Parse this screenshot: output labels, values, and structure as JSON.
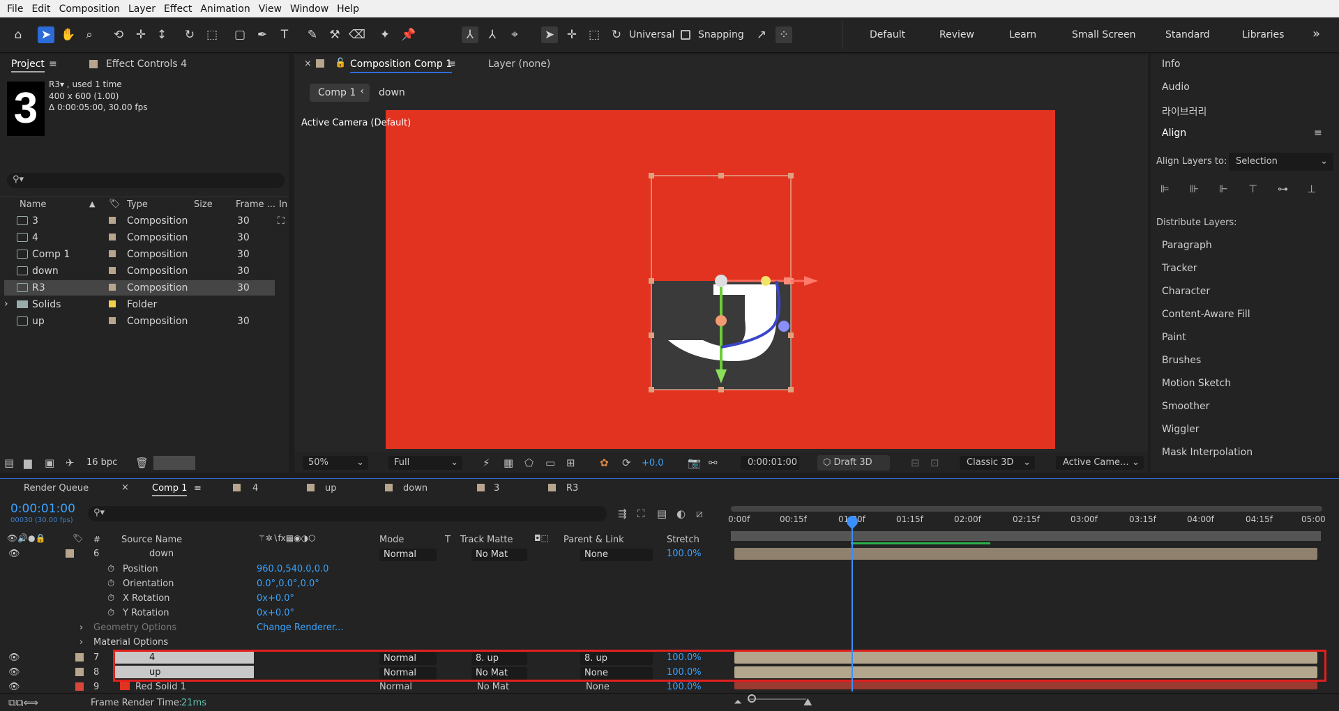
{
  "menu": [
    "File",
    "Edit",
    "Composition",
    "Layer",
    "Effect",
    "Animation",
    "View",
    "Window",
    "Help"
  ],
  "toolbar": {
    "universal_label": "Universal",
    "snapping_label": "Snapping"
  },
  "workspaces": [
    "Default",
    "Review",
    "Learn",
    "Small Screen",
    "Standard",
    "Libraries"
  ],
  "workspaces_more": "»",
  "project": {
    "tab_project": "Project",
    "tab_effect": "Effect Controls 4",
    "thumb_text": "3",
    "item_name": "R3▾ , used 1 time",
    "item_dims": "400 x 600 (1.00)",
    "item_dur": "Δ 0:00:05:00, 30.00 fps",
    "search_icon": "⚲▾",
    "cols": {
      "name": "Name",
      "type": "Type",
      "size": "Size",
      "frame": "Frame ...",
      "in": "In"
    },
    "items": [
      {
        "name": "3",
        "type": "Composition",
        "frame": "30"
      },
      {
        "name": "4",
        "type": "Composition",
        "frame": "30"
      },
      {
        "name": "Comp 1",
        "type": "Composition",
        "frame": "30"
      },
      {
        "name": "down",
        "type": "Composition",
        "frame": "30"
      },
      {
        "name": "R3",
        "type": "Composition",
        "frame": "30"
      },
      {
        "name": "Solids",
        "type": "Folder",
        "frame": ""
      },
      {
        "name": "up",
        "type": "Composition",
        "frame": "30"
      }
    ],
    "bpc": "16 bpc"
  },
  "comp": {
    "tab": "Composition Comp 1",
    "layer_tab": "Layer (none)",
    "crumb1": "Comp 1",
    "crumb2": "down",
    "camera": "Active Camera (Default)",
    "zoom": "50%",
    "res": "Full",
    "exposure": "+0.0",
    "time": "0:00:01:00",
    "draft": "Draft 3D",
    "renderer": "Classic 3D",
    "view": "Active Came...",
    "bg_color": "#e23321"
  },
  "right_panels": [
    "Info",
    "Audio",
    "라이브러리",
    "Align"
  ],
  "align": {
    "label": "Align Layers to:",
    "value": "Selection",
    "distribute": "Distribute Layers:"
  },
  "right_more": [
    "Paragraph",
    "Tracker",
    "Character",
    "Content-Aware Fill",
    "Paint",
    "Brushes",
    "Motion Sketch",
    "Smoother",
    "Wiggler",
    "Mask Interpolation"
  ],
  "timeline": {
    "tabs": [
      "Render Queue",
      "Comp 1",
      "4",
      "up",
      "down",
      "3",
      "R3"
    ],
    "timecode": "0:00:01:00",
    "fps": "00030 (30.00 fps)",
    "cols": {
      "num": "#",
      "source": "Source Name",
      "mode": "Mode",
      "t": "T",
      "matte": "Track Matte",
      "parent": "Parent & Link",
      "stretch": "Stretch"
    },
    "ruler": [
      "0:00f",
      "00:15f",
      "01:00f",
      "01:15f",
      "02:00f",
      "02:15f",
      "03:00f",
      "03:15f",
      "04:00f",
      "04:15f",
      "05:00"
    ],
    "layer6": {
      "num": "6",
      "name": "down",
      "mode": "Normal",
      "matte": "No Mat",
      "parent": "None",
      "stretch": "100.0%"
    },
    "props": [
      {
        "name": "Position",
        "value": "960.0,540.0,0.0"
      },
      {
        "name": "Orientation",
        "value": "0.0°,0.0°,0.0°"
      },
      {
        "name": "X Rotation",
        "value": "0x+0.0°"
      },
      {
        "name": "Y Rotation",
        "value": "0x+0.0°"
      }
    ],
    "geom": "Geometry Options",
    "change_renderer": "Change Renderer...",
    "material": "Material Options",
    "layer7": {
      "num": "7",
      "name": "4",
      "mode": "Normal",
      "matte": "8. up",
      "parent": "8. up",
      "stretch": "100.0%"
    },
    "layer8": {
      "num": "8",
      "name": "up",
      "mode": "Normal",
      "matte": "No Mat",
      "parent": "None",
      "stretch": "100.0%"
    },
    "layer9": {
      "num": "9",
      "name": "Red Solid 1",
      "mode": "Normal",
      "matte": "No Mat",
      "parent": "None",
      "stretch": "100.0%"
    },
    "render_time_label": "Frame Render Time:",
    "render_time": "21ms"
  }
}
